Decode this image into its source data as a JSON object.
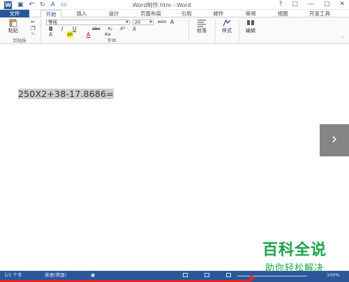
{
  "titlebar": {
    "title": "Word制作.htm - Word",
    "help": "?",
    "restore": "□",
    "minimize": "—",
    "maximize": "□",
    "close": "✕"
  },
  "tabs": [
    {
      "label": "文件"
    },
    {
      "label": "开始"
    },
    {
      "label": "插入"
    },
    {
      "label": "设计"
    },
    {
      "label": "页面布局"
    },
    {
      "label": "引用"
    },
    {
      "label": "邮件"
    },
    {
      "label": "审阅"
    },
    {
      "label": "视图"
    },
    {
      "label": "开发工具"
    }
  ],
  "ribbon": {
    "paste_label": "粘贴",
    "clipboard_group": "剪贴板",
    "font_group": "字体",
    "font_name": "等线",
    "font_size": "20",
    "wen": "wén",
    "paragraph_label": "段落",
    "styles_label": "样式",
    "editing_label": "编辑",
    "bold": "B",
    "italic": "I",
    "underline": "U",
    "strike": "abc",
    "sub": "X₂",
    "sup": "X²",
    "font_color": "A",
    "case": "Aa",
    "grow": "A",
    "highlight_label": "ab"
  },
  "document": {
    "line": "250X2+38-17.8686="
  },
  "status": {
    "page": "1/1 个字",
    "language": "英语(美国)",
    "zoom": "100%"
  },
  "player": {
    "progress": 0.72
  },
  "watermark": {
    "main": "百科全说",
    "sub": "助你轻松解决"
  },
  "colors": {
    "accent": "#2b579a",
    "progress": "#e0261e",
    "watermark": "#1aa34a"
  }
}
